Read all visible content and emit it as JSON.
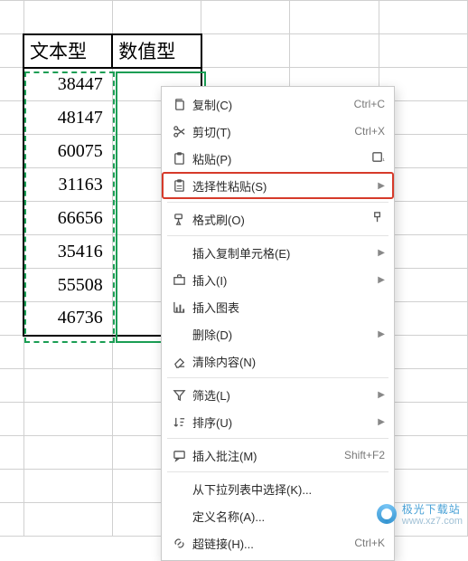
{
  "headers": {
    "colA": "文本型",
    "colB": "数值型"
  },
  "rows": [
    {
      "a": "38447"
    },
    {
      "a": "48147"
    },
    {
      "a": "60075"
    },
    {
      "a": "31163"
    },
    {
      "a": "66656"
    },
    {
      "a": "35416"
    },
    {
      "a": "55508"
    },
    {
      "a": "46736"
    }
  ],
  "menu": {
    "copy": {
      "label": "复制(C)",
      "shortcut": "Ctrl+C"
    },
    "cut": {
      "label": "剪切(T)",
      "shortcut": "Ctrl+X"
    },
    "paste": {
      "label": "粘贴(P)"
    },
    "paste_special": {
      "label": "选择性粘贴(S)"
    },
    "format_painter": {
      "label": "格式刷(O)"
    },
    "insert_copied": {
      "label": "插入复制单元格(E)"
    },
    "insert": {
      "label": "插入(I)"
    },
    "insert_chart": {
      "label": "插入图表"
    },
    "delete": {
      "label": "删除(D)"
    },
    "clear": {
      "label": "清除内容(N)"
    },
    "filter": {
      "label": "筛选(L)"
    },
    "sort": {
      "label": "排序(U)"
    },
    "insert_comment": {
      "label": "插入批注(M)",
      "shortcut": "Shift+F2"
    },
    "pick_list": {
      "label": "从下拉列表中选择(K)..."
    },
    "define_name": {
      "label": "定义名称(A)..."
    },
    "hyperlink": {
      "label": "超链接(H)...",
      "shortcut": "Ctrl+K"
    }
  },
  "watermark": {
    "line1": "极光下载站",
    "line2": "www.xz7.com"
  }
}
